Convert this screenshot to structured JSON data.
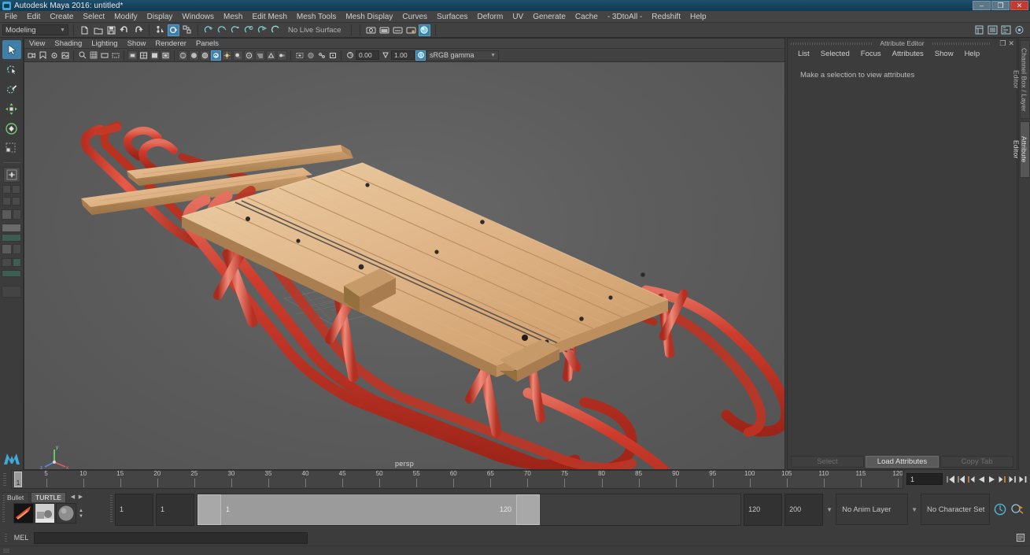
{
  "window": {
    "title": "Autodesk Maya 2016: untitled*",
    "app_icon": "maya-logo-icon",
    "minimize_label": "–",
    "restore_label": "❐",
    "close_label": "✕"
  },
  "menubar": {
    "items": [
      {
        "label": "File"
      },
      {
        "label": "Edit"
      },
      {
        "label": "Create"
      },
      {
        "label": "Select"
      },
      {
        "label": "Modify"
      },
      {
        "label": "Display"
      },
      {
        "label": "Windows"
      },
      {
        "label": "Mesh"
      },
      {
        "label": "Edit Mesh"
      },
      {
        "label": "Mesh Tools"
      },
      {
        "label": "Mesh Display"
      },
      {
        "label": "Curves"
      },
      {
        "label": "Surfaces"
      },
      {
        "label": "Deform"
      },
      {
        "label": "UV"
      },
      {
        "label": "Generate"
      },
      {
        "label": "Cache"
      },
      {
        "label": "- 3DtoAll -"
      },
      {
        "label": "Redshift"
      },
      {
        "label": "Help"
      }
    ]
  },
  "statusbar": {
    "menu_set": "Modeling",
    "menu_set_arrow": "▼",
    "live_surface": "No Live Surface",
    "icons": [
      "new-scene-icon",
      "open-scene-icon",
      "save-scene-icon",
      "undo-icon",
      "redo-icon",
      "select-by-hierarchy-icon",
      "select-by-object-icon",
      "select-by-component-icon",
      "snap-to-grid-icon",
      "snap-to-curve-icon",
      "snap-to-point-icon",
      "snap-to-projected-center-icon",
      "snap-to-view-plane-icon",
      "make-live-icon",
      "show-render-view-icon",
      "render-current-frame-icon",
      "ipr-render-icon",
      "render-settings-icon",
      "hypershade-icon",
      "sidebar-channel-box-icon",
      "sidebar-attribute-editor-icon",
      "sidebar-tool-settings-icon",
      "sidebar-modeling-toolkit-icon"
    ]
  },
  "toolbox": {
    "tools": [
      {
        "name": "select-tool",
        "active": true
      },
      {
        "name": "lasso-select-tool",
        "active": false
      },
      {
        "name": "paint-select-tool",
        "active": false
      },
      {
        "name": "move-tool",
        "active": false
      },
      {
        "name": "rotate-tool",
        "active": false
      },
      {
        "name": "scale-tool",
        "active": false
      },
      {
        "name": "last-tool-used",
        "active": false
      }
    ],
    "layout_presets": [
      "single-perspective-layout",
      "four-view-layout",
      "persp-outliner-layout",
      "persp-graph-editor-layout",
      "two-panes-side-by-side-layout",
      "two-panes-stacked-layout",
      "persp-hypershade-layout",
      "persp-render-view-layout",
      "three-pane-split-layout",
      "outliner-persp-layout",
      "persp-uv-editor-layout",
      "single-pane-layout"
    ]
  },
  "viewport": {
    "panel_menus": [
      {
        "label": "View"
      },
      {
        "label": "Shading"
      },
      {
        "label": "Lighting"
      },
      {
        "label": "Show"
      },
      {
        "label": "Renderer"
      },
      {
        "label": "Panels"
      }
    ],
    "exposure_value": "0.00",
    "gamma_value": "1.00",
    "color_management": "sRGB gamma",
    "color_management_arrow": "▼",
    "camera_label": "persp",
    "toolbar_icons": [
      "select-camera-icon",
      "bookmarks-icon",
      "camera-attributes-icon",
      "image-plane-icon",
      "two-d-pan-zoom-icon",
      "grid-toggle-icon",
      "film-gate-icon",
      "resolution-gate-icon",
      "gate-mask-icon",
      "field-chart-icon",
      "safe-action-icon",
      "safe-title-icon",
      "wireframe-icon",
      "smooth-shade-all-icon",
      "shaded-wireframe-icon",
      "textured-icon",
      "use-all-lights-icon",
      "shadows-icon",
      "screen-space-ao-icon",
      "motion-blur-icon",
      "multisample-aa-icon",
      "depth-of-field-icon",
      "isolate-select-icon",
      "xray-icon",
      "xray-joints-icon",
      "xray-active-components-icon",
      "exposure-icon",
      "gamma-icon",
      "color-management-toggle-icon"
    ]
  },
  "attribute_editor": {
    "title": "Attribute Editor",
    "undock_label": "❐",
    "close_label": "✕",
    "menus": [
      {
        "label": "List"
      },
      {
        "label": "Selected"
      },
      {
        "label": "Focus"
      },
      {
        "label": "Attributes"
      },
      {
        "label": "Show"
      },
      {
        "label": "Help"
      }
    ],
    "message": "Make a selection to view attributes",
    "buttons": [
      {
        "label": "Select",
        "enabled": false
      },
      {
        "label": "Load Attributes",
        "enabled": true
      },
      {
        "label": "Copy Tab",
        "enabled": false
      }
    ]
  },
  "right_tabs": [
    {
      "label": "Channel Box / Layer Editor",
      "active": false
    },
    {
      "label": "Attribute Editor",
      "active": true
    }
  ],
  "timeline": {
    "start": 1,
    "end": 120,
    "tick_step": 5,
    "labels": [
      5,
      10,
      15,
      20,
      25,
      30,
      35,
      40,
      45,
      50,
      55,
      60,
      65,
      70,
      75,
      80,
      85,
      90,
      95,
      100,
      105,
      110,
      115,
      120
    ],
    "current_frame": "1",
    "current_frame_field": "1",
    "playback_buttons": [
      "go-to-start-icon",
      "step-back-frame-icon",
      "step-back-key-icon",
      "play-backwards-icon",
      "play-forwards-icon",
      "step-forward-key-icon",
      "step-forward-frame-icon",
      "go-to-end-icon"
    ]
  },
  "range_slider": {
    "shelf_tabs": [
      {
        "label": "Bullet",
        "active": false
      },
      {
        "label": "TURTLE",
        "active": true
      }
    ],
    "shelf_arrow_left": "◀",
    "shelf_arrow_right": "▶",
    "shelf_icons": [
      "turtle-bake-layer-icon",
      "turtle-render-icon",
      "turtle-material-icon"
    ],
    "spin_up": "▲",
    "spin_down": "▼",
    "anim_start": "1",
    "playback_start": "1",
    "range_bar_start_label": "1",
    "range_bar_end_label": "120",
    "playback_end": "120",
    "anim_end": "200",
    "anim_layer": "No Anim Layer",
    "anim_layer_arrow": "▼",
    "character_set": "No Character Set",
    "character_set_arrow": "▼",
    "auto_key_icon": "auto-keyframe-icon",
    "anim_prefs_icon": "animation-preferences-icon"
  },
  "command_line": {
    "language_label": "MEL",
    "input_value": "",
    "input_placeholder": "",
    "script_editor_icon": "script-editor-icon"
  },
  "colors": {
    "accent_blue": "#3f7fa8",
    "title_blue": "#17455f",
    "panel_bg": "#3c3c3c",
    "viewport_bg": "#5b5b5b",
    "sled_red": "#c0392b",
    "sled_wood": "#d4a373",
    "close_red": "#c23b2e",
    "turtle_orange": "#c4642a"
  }
}
